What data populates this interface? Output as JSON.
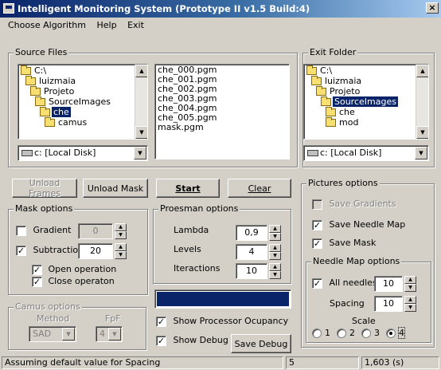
{
  "window": {
    "title": "Intelligent Monitoring System (Prototype II v1.5 Build:4)",
    "close": "×"
  },
  "menu": [
    "Choose Algorithm",
    "Help",
    "Exit"
  ],
  "source": {
    "group_title": "Source Files",
    "tree": [
      {
        "label": "C:\\",
        "indent": 0,
        "icon": "folder-open-icon"
      },
      {
        "label": "luizmaia",
        "indent": 1,
        "icon": "folder-open-icon"
      },
      {
        "label": "Projeto",
        "indent": 2,
        "icon": "folder-open-icon"
      },
      {
        "label": "SourceImages",
        "indent": 3,
        "icon": "folder-open-icon"
      },
      {
        "label": "che",
        "indent": 4,
        "icon": "folder-open-icon",
        "selected": true
      },
      {
        "label": "camus",
        "indent": 5,
        "icon": "folder-icon"
      }
    ],
    "drive": "c: [Local Disk]",
    "files": [
      "che_000.pgm",
      "che_001.pgm",
      "che_002.pgm",
      "che_003.pgm",
      "che_004.pgm",
      "che_005.pgm",
      "mask.pgm"
    ]
  },
  "exit_folder": {
    "group_title": "Exit Folder",
    "tree": [
      {
        "label": "C:\\",
        "indent": 0,
        "icon": "folder-open-icon"
      },
      {
        "label": "luizmaia",
        "indent": 1,
        "icon": "folder-open-icon"
      },
      {
        "label": "Projeto",
        "indent": 2,
        "icon": "folder-open-icon"
      },
      {
        "label": "SourceImages",
        "indent": 3,
        "icon": "folder-open-icon",
        "selected": true
      },
      {
        "label": "che",
        "indent": 4,
        "icon": "folder-icon"
      },
      {
        "label": "mod",
        "indent": 4,
        "icon": "folder-icon"
      }
    ],
    "drive": "c: [Local Disk]"
  },
  "buttons": {
    "unload_frames": "Unload Frames",
    "unload_mask": "Unload Mask",
    "start": "Start",
    "clear": "Clear",
    "save_debug": "Save Debug"
  },
  "mask_options": {
    "title": "Mask options",
    "gradient": {
      "label": "Gradient",
      "checked": false,
      "value": "0"
    },
    "subtraction": {
      "label": "Subtraction",
      "checked": true,
      "value": "20"
    },
    "open_operation": {
      "label": "Open operation",
      "checked": true
    },
    "close_operation": {
      "label": "Close operaton",
      "checked": true
    }
  },
  "proesman": {
    "title": "Proesman options",
    "lambda": {
      "label": "Lambda",
      "value": "0,9"
    },
    "levels": {
      "label": "Levels",
      "value": "4"
    },
    "iteractions": {
      "label": "Iteractions",
      "value": "10"
    }
  },
  "camus": {
    "title": "Camus options",
    "method_label": "Method",
    "method_value": "SAD",
    "fpf_label": "FpF",
    "fpf_value": "4"
  },
  "show_processor": {
    "label": "Show Processor Ocupancy",
    "checked": true
  },
  "show_debug": {
    "label": "Show Debug",
    "checked": true
  },
  "pictures": {
    "title": "Pictures options",
    "save_gradients": {
      "label": "Save Gradients",
      "checked": false,
      "enabled": false
    },
    "save_needle_map": {
      "label": "Save Needle Map",
      "checked": true
    },
    "save_mask": {
      "label": "Save Mask",
      "checked": true
    }
  },
  "needle": {
    "title": "Needle Map options",
    "all_needles": {
      "label": "All needles",
      "checked": true,
      "value": "10"
    },
    "spacing": {
      "label": "Spacing",
      "value": "10"
    },
    "scale_label": "Scale",
    "scale_options": [
      "1",
      "2",
      "3",
      "4"
    ],
    "scale_selected": "4"
  },
  "status": {
    "message": "Assuming default value for Spacing",
    "value": "5",
    "time": "1,603 (s)"
  },
  "colors": {
    "title_start": "#0a246a",
    "title_end": "#a6caf0",
    "selection": "#0a246a",
    "progress": "#0a246a",
    "face": "#d4d0c8"
  }
}
